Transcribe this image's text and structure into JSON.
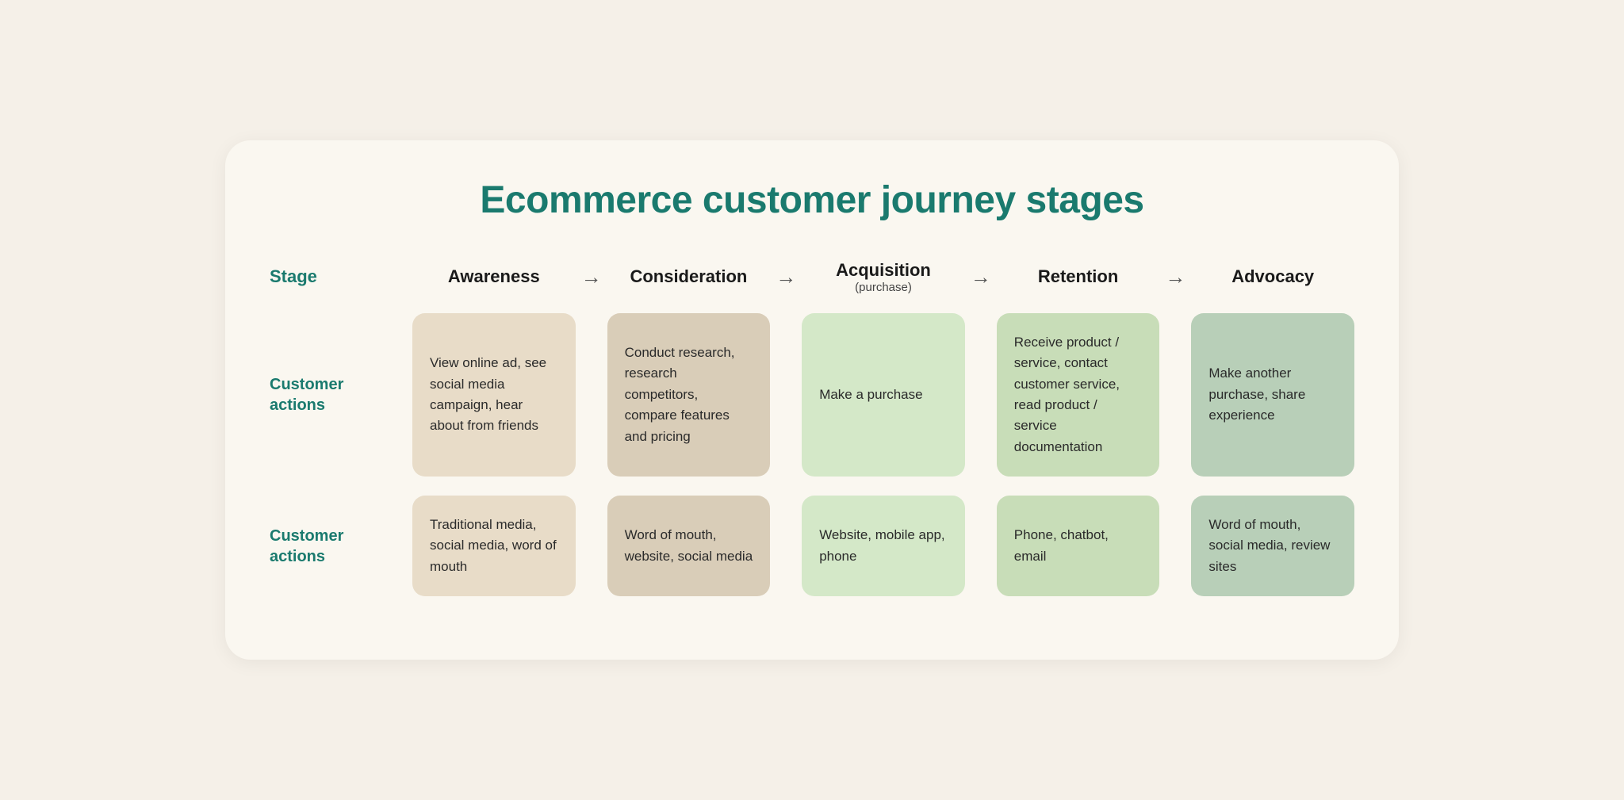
{
  "title": "Ecommerce customer journey stages",
  "stage_label": "Stage",
  "columns": [
    {
      "label": "Awareness",
      "sub": ""
    },
    {
      "label": "Consideration",
      "sub": ""
    },
    {
      "label": "Acquisition",
      "sub": "(purchase)"
    },
    {
      "label": "Retention",
      "sub": ""
    },
    {
      "label": "Advocacy",
      "sub": ""
    }
  ],
  "rows": [
    {
      "label": "Customer actions",
      "cells": [
        "View online ad, see social media campaign, hear about from friends",
        "Conduct research, research competitors, compare features and pricing",
        "Make a purchase",
        "Receive product / service, contact customer service, read product / service documentation",
        "Make another purchase, share experience"
      ]
    },
    {
      "label": "Customer actions",
      "cells": [
        "Traditional media, social media, word of mouth",
        "Word of mouth, website, social media",
        "Website, mobile app, phone",
        "Phone, chatbot, email",
        "Word of mouth, social media, review sites"
      ]
    }
  ],
  "arrow": "→"
}
